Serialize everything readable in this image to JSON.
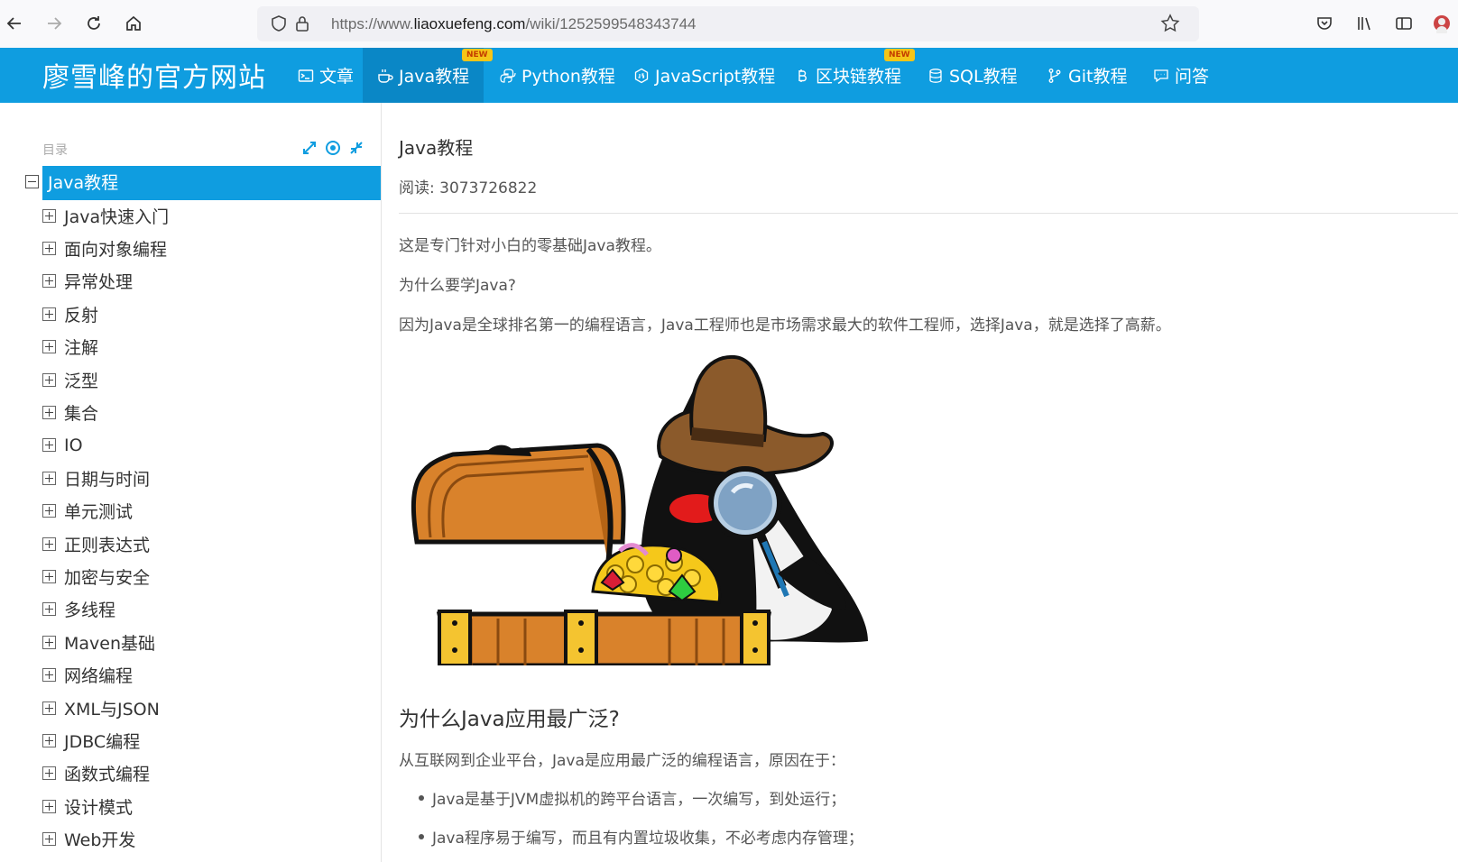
{
  "browser": {
    "url_prefix": "https://www.",
    "url_domain": "liaoxuefeng.com",
    "url_path": "/wiki/1252599548343744"
  },
  "site": {
    "brand": "廖雪峰的官方网站",
    "nav": [
      {
        "label": "文章",
        "icon": "terminal-icon",
        "active": false,
        "badge": ""
      },
      {
        "label": "Java教程",
        "icon": "coffee-icon",
        "active": true,
        "badge": "NEW"
      },
      {
        "label": "Python教程",
        "icon": "python-icon",
        "active": false,
        "badge": ""
      },
      {
        "label": "JavaScript教程",
        "icon": "hexagon-icon",
        "active": false,
        "badge": ""
      },
      {
        "label": "区块链教程",
        "icon": "bitcoin-icon",
        "active": false,
        "badge": "NEW"
      },
      {
        "label": "SQL教程",
        "icon": "database-icon",
        "active": false,
        "badge": ""
      },
      {
        "label": "Git教程",
        "icon": "branch-icon",
        "active": false,
        "badge": ""
      },
      {
        "label": "问答",
        "icon": "comment-icon",
        "active": false,
        "badge": ""
      }
    ]
  },
  "sidebar": {
    "toc_label": "目录",
    "root": "Java教程",
    "items": [
      "Java快速入门",
      "面向对象编程",
      "异常处理",
      "反射",
      "注解",
      "泛型",
      "集合",
      "IO",
      "日期与时间",
      "单元测试",
      "正则表达式",
      "加密与安全",
      "多线程",
      "Maven基础",
      "网络编程",
      "XML与JSON",
      "JDBC编程",
      "函数式编程",
      "设计模式",
      "Web开发"
    ]
  },
  "content": {
    "title": "Java教程",
    "read_count": "阅读: 3073726822",
    "intro": "这是专门针对小白的零基础Java教程。",
    "question": "为什么要学Java?",
    "answer": "因为Java是全球排名第一的编程语言，Java工程师也是市场需求最大的软件工程师，选择Java，就是选择了高薪。",
    "h2": "为什么Java应用最广泛?",
    "reason_intro": "从互联网到企业平台，Java是应用最广泛的编程语言，原因在于：",
    "bullets": [
      "Java是基于JVM虚拟机的跨平台语言，一次编写，到处运行；",
      "Java程序易于编写，而且有内置垃圾收集，不必考虑内存管理；"
    ]
  },
  "colors": {
    "header_bg": "#0f9de0",
    "active_bg": "#0a87c6",
    "badge_bg": "#f5c518"
  }
}
